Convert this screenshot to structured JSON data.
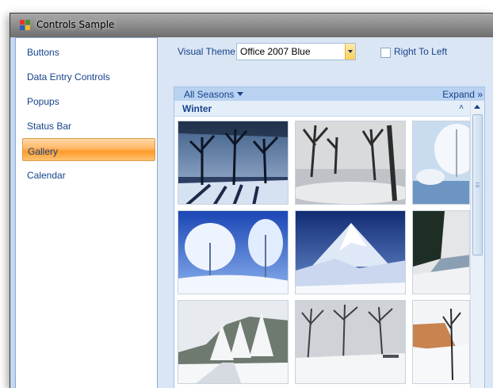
{
  "window": {
    "title": "Controls Sample",
    "icon": "app-window-icon"
  },
  "sidebar": {
    "items": [
      {
        "label": "Buttons",
        "selected": false
      },
      {
        "label": "Data Entry Controls",
        "selected": false
      },
      {
        "label": "Popups",
        "selected": false
      },
      {
        "label": "Status Bar",
        "selected": false
      },
      {
        "label": "Gallery",
        "selected": true
      },
      {
        "label": "Calendar",
        "selected": false
      }
    ]
  },
  "toolbar": {
    "theme_label": "Visual Theme",
    "theme_value": "Office 2007 Blue",
    "rtl_label": "Right To Left",
    "rtl_checked": false
  },
  "gallery": {
    "filter_label": "All Seasons",
    "expand_label": "Expand »",
    "group_title": "Winter",
    "collapse_icon": "˄",
    "thumbnails": [
      {
        "name": "winter-photo-1",
        "scene": "dark-forest"
      },
      {
        "name": "winter-photo-2",
        "scene": "foggy-trees"
      },
      {
        "name": "winter-photo-3",
        "scene": "frosted-lake"
      },
      {
        "name": "winter-photo-4",
        "scene": "frosted-tree-blue"
      },
      {
        "name": "winter-photo-5",
        "scene": "snow-mountain"
      },
      {
        "name": "winter-photo-6",
        "scene": "snowy-river"
      },
      {
        "name": "winter-photo-7",
        "scene": "snowy-forest-road"
      },
      {
        "name": "winter-photo-8",
        "scene": "snowy-park"
      },
      {
        "name": "winter-photo-9",
        "scene": "frozen-shore"
      }
    ]
  },
  "colors": {
    "accent_selected": "#ff9c2a",
    "text": "#15428b",
    "panel_bg": "#dae6f5"
  }
}
